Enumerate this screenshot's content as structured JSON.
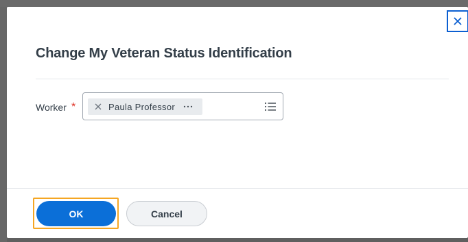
{
  "dialog": {
    "title": "Change My Veteran Status Identification",
    "close_icon": "close-icon"
  },
  "form": {
    "worker_label": "Worker",
    "required_marker": "*",
    "selected_worker": "Paula Professor",
    "pill_remove_icon": "close-icon",
    "pill_more_icon": "ellipsis-icon",
    "prompt_icon": "list-icon"
  },
  "footer": {
    "ok_label": "OK",
    "cancel_label": "Cancel"
  },
  "colors": {
    "primary": "#0b6fd8",
    "focus_ring": "#f5a623",
    "required": "#de2e21"
  }
}
